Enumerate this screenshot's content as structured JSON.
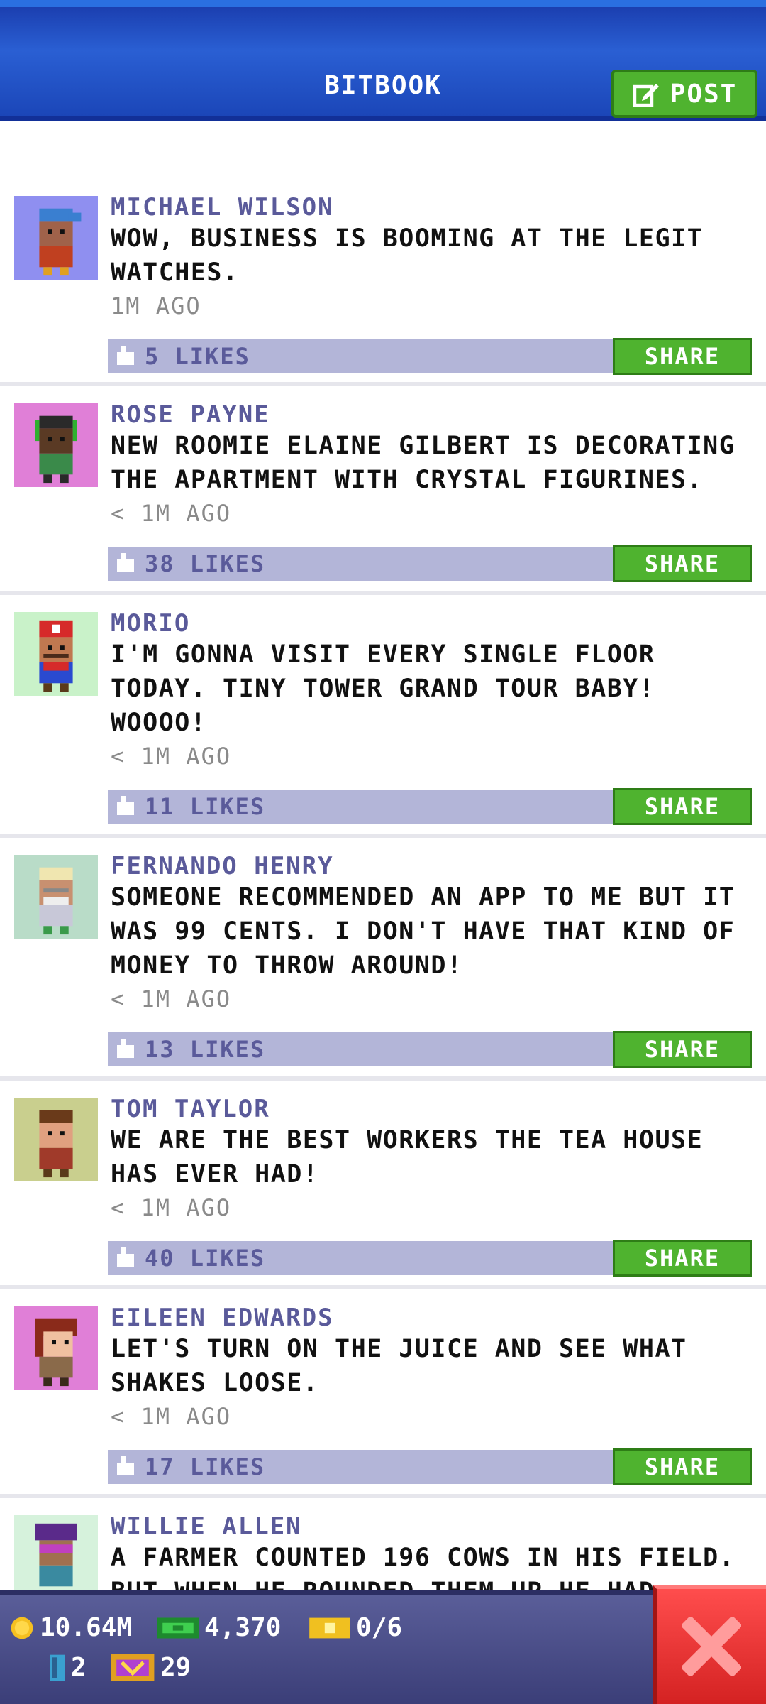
{
  "header": {
    "title": "BITBOOK",
    "post_label": "POST"
  },
  "feed": [
    {
      "name": "MICHAEL WILSON",
      "text": "WOW, BUSINESS IS BOOMING AT THE LEGIT WATCHES.",
      "time": "1M AGO",
      "likes": "5 LIKES",
      "share": "SHARE",
      "avatar_bg": "#8f8ff0"
    },
    {
      "name": "ROSE PAYNE",
      "text": "NEW ROOMIE ELAINE GILBERT IS DECORATING THE APARTMENT WITH CRYSTAL FIGURINES.",
      "time": "< 1M AGO",
      "likes": "38 LIKES",
      "share": "SHARE",
      "avatar_bg": "#e07fd7"
    },
    {
      "name": "MORIO",
      "text": "I'M GONNA VISIT EVERY SINGLE FLOOR TODAY. TINY TOWER GRAND TOUR BABY! WOOOO!",
      "time": "< 1M AGO",
      "likes": "11 LIKES",
      "share": "SHARE",
      "avatar_bg": "#c9f2c9"
    },
    {
      "name": "FERNANDO HENRY",
      "text": "SOMEONE RECOMMENDED AN APP TO ME BUT IT WAS 99 CENTS. I DON'T HAVE THAT KIND OF MONEY TO THROW AROUND!",
      "time": "< 1M AGO",
      "likes": "13 LIKES",
      "share": "SHARE",
      "avatar_bg": "#b9dcc8"
    },
    {
      "name": "TOM TAYLOR",
      "text": "WE ARE THE BEST WORKERS THE TEA HOUSE HAS EVER HAD!",
      "time": "< 1M AGO",
      "likes": "40 LIKES",
      "share": "SHARE",
      "avatar_bg": "#c9cf8e"
    },
    {
      "name": "EILEEN EDWARDS",
      "text": "LET'S TURN ON THE JUICE AND SEE WHAT SHAKES LOOSE.",
      "time": "< 1M AGO",
      "likes": "17 LIKES",
      "share": "SHARE",
      "avatar_bg": "#e07fd7"
    },
    {
      "name": "WILLIE ALLEN",
      "text": "A FARMER COUNTED 196 COWS IN HIS FIELD. BUT WHEN HE ROUNDED THEM UP HE HAD",
      "time": "",
      "likes": "",
      "share": "",
      "avatar_bg": "#d6f2dc"
    }
  ],
  "footer": {
    "coins": "10.64M",
    "bux": "4,370",
    "tickets": "0/6",
    "keys": "2",
    "vip": "29"
  },
  "colors": {
    "header": "#1b46b8",
    "green": "#4fb32f",
    "like_bar": "#b3b5d8",
    "name": "#5a5a9a",
    "close": "#e23030"
  }
}
